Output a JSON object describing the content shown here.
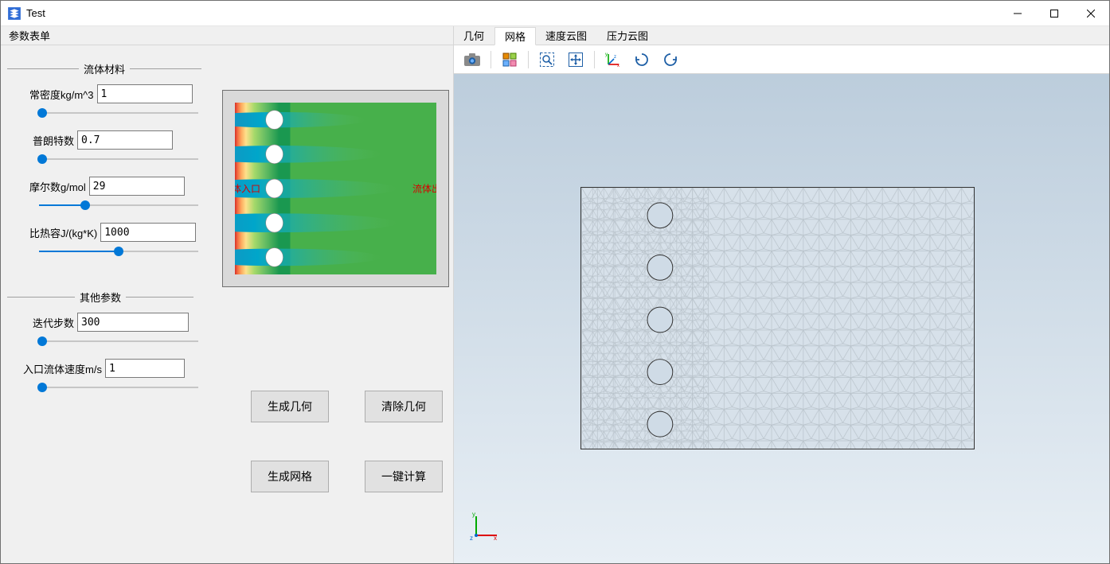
{
  "window": {
    "title": "Test"
  },
  "menubar": {
    "param_form": "参数表单"
  },
  "tabs": {
    "geometry": "几何",
    "mesh": "网格",
    "velocity": "速度云图",
    "pressure": "压力云图",
    "active": "mesh"
  },
  "group_fluid": {
    "title": "流体材料",
    "density_label": "常密度kg/m^3",
    "density_value": "1",
    "density_fill_pct": 2,
    "prandtl_label": "普朗特数",
    "prandtl_value": "0.7",
    "prandtl_fill_pct": 2,
    "molar_label": "摩尔数g/mol",
    "molar_value": "29",
    "molar_fill_pct": 29,
    "cp_label": "比热容J/(kg*K)",
    "cp_value": "1000",
    "cp_fill_pct": 50
  },
  "group_other": {
    "title": "其他参数",
    "iter_label": "迭代步数",
    "iter_value": "300",
    "iter_fill_pct": 2,
    "inlet_vel_label": "入口流体速度m/s",
    "inlet_vel_value": "1",
    "inlet_vel_fill_pct": 2
  },
  "preview": {
    "inlet_text": "流体入口",
    "outlet_text": "流体出口"
  },
  "buttons": {
    "gen_geometry": "生成几何",
    "clear_geometry": "清除几何",
    "gen_mesh": "生成网格",
    "compute": "一键计算"
  },
  "toolbar_icons": {
    "camera": "camera-icon",
    "multi": "multiselect-icon",
    "zoom": "zoom-box-icon",
    "pan": "pan-icon",
    "axes": "axes-icon",
    "rot1": "rotate-cw-icon",
    "rot2": "rotate-ccw-icon"
  }
}
